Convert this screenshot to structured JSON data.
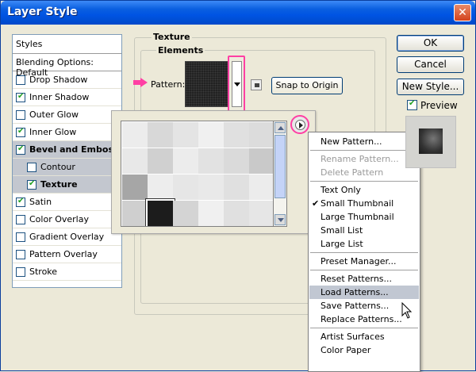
{
  "window": {
    "title": "Layer Style",
    "close_icon": "close-icon"
  },
  "styles_panel": {
    "header": "Styles",
    "blending": "Blending Options: Default",
    "items": [
      {
        "label": "Drop Shadow",
        "checked": false,
        "bold": false,
        "selected": false,
        "indent": 0
      },
      {
        "label": "Inner Shadow",
        "checked": true,
        "bold": false,
        "selected": false,
        "indent": 0
      },
      {
        "label": "Outer Glow",
        "checked": false,
        "bold": false,
        "selected": false,
        "indent": 0
      },
      {
        "label": "Inner Glow",
        "checked": true,
        "bold": false,
        "selected": false,
        "indent": 0
      },
      {
        "label": "Bevel and Emboss",
        "checked": true,
        "bold": true,
        "selected": true,
        "indent": 0
      },
      {
        "label": "Contour",
        "checked": false,
        "bold": false,
        "selected": true,
        "indent": 1
      },
      {
        "label": "Texture",
        "checked": true,
        "bold": true,
        "selected": true,
        "indent": 1
      },
      {
        "label": "Satin",
        "checked": true,
        "bold": false,
        "selected": false,
        "indent": 0
      },
      {
        "label": "Color Overlay",
        "checked": false,
        "bold": false,
        "selected": false,
        "indent": 0
      },
      {
        "label": "Gradient Overlay",
        "checked": false,
        "bold": false,
        "selected": false,
        "indent": 0
      },
      {
        "label": "Pattern Overlay",
        "checked": false,
        "bold": false,
        "selected": false,
        "indent": 0
      },
      {
        "label": "Stroke",
        "checked": false,
        "bold": false,
        "selected": false,
        "indent": 0
      }
    ]
  },
  "texture": {
    "group_title": "Texture",
    "elements_title": "Elements",
    "pattern_label": "Pattern:",
    "snap_button": "Snap to Origin"
  },
  "pattern_picker": {
    "selected_index": 19,
    "tiles": [
      "#ececec",
      "#d8d8d8",
      "#e4e4e4",
      "#f0f0f0",
      "#e0e0e0",
      "#dcdcdc",
      "#e8e8e8",
      "#d0d0d0",
      "#ececec",
      "#e2e2e2",
      "#dadada",
      "#c9c9c9",
      "#a6a6a6",
      "#ededed",
      "#e6e6e6",
      "#e9e9e9",
      "#e0e0e0",
      "#ececec",
      "#cfcfcf",
      "#1c1c1c",
      "#d4d4d4",
      "#f0f0f0",
      "#e0e0e0",
      "#e6e6e6"
    ]
  },
  "context_menu": {
    "items": [
      {
        "label": "New Pattern...",
        "disabled": false,
        "checked": false,
        "hovered": false,
        "sep_before": false
      },
      {
        "label": "Rename Pattern...",
        "disabled": true,
        "checked": false,
        "hovered": false,
        "sep_before": true
      },
      {
        "label": "Delete Pattern",
        "disabled": true,
        "checked": false,
        "hovered": false,
        "sep_before": false
      },
      {
        "label": "Text Only",
        "disabled": false,
        "checked": false,
        "hovered": false,
        "sep_before": true
      },
      {
        "label": "Small Thumbnail",
        "disabled": false,
        "checked": true,
        "hovered": false,
        "sep_before": false
      },
      {
        "label": "Large Thumbnail",
        "disabled": false,
        "checked": false,
        "hovered": false,
        "sep_before": false
      },
      {
        "label": "Small List",
        "disabled": false,
        "checked": false,
        "hovered": false,
        "sep_before": false
      },
      {
        "label": "Large List",
        "disabled": false,
        "checked": false,
        "hovered": false,
        "sep_before": false
      },
      {
        "label": "Preset Manager...",
        "disabled": false,
        "checked": false,
        "hovered": false,
        "sep_before": true
      },
      {
        "label": "Reset Patterns...",
        "disabled": false,
        "checked": false,
        "hovered": false,
        "sep_before": true
      },
      {
        "label": "Load Patterns...",
        "disabled": false,
        "checked": false,
        "hovered": true,
        "sep_before": false
      },
      {
        "label": "Save Patterns...",
        "disabled": false,
        "checked": false,
        "hovered": false,
        "sep_before": false
      },
      {
        "label": "Replace Patterns...",
        "disabled": false,
        "checked": false,
        "hovered": false,
        "sep_before": false
      },
      {
        "label": "Artist Surfaces",
        "disabled": false,
        "checked": false,
        "hovered": false,
        "sep_before": true
      },
      {
        "label": "Color Paper",
        "disabled": false,
        "checked": false,
        "hovered": false,
        "sep_before": false
      }
    ]
  },
  "buttons": {
    "ok": "OK",
    "cancel": "Cancel",
    "new_style": "New Style..."
  },
  "preview": {
    "label": "Preview",
    "checked": true
  },
  "colors": {
    "highlight": "#ff3fa4",
    "titlebar": "#0054e3",
    "selection": "#c3c7cf"
  }
}
